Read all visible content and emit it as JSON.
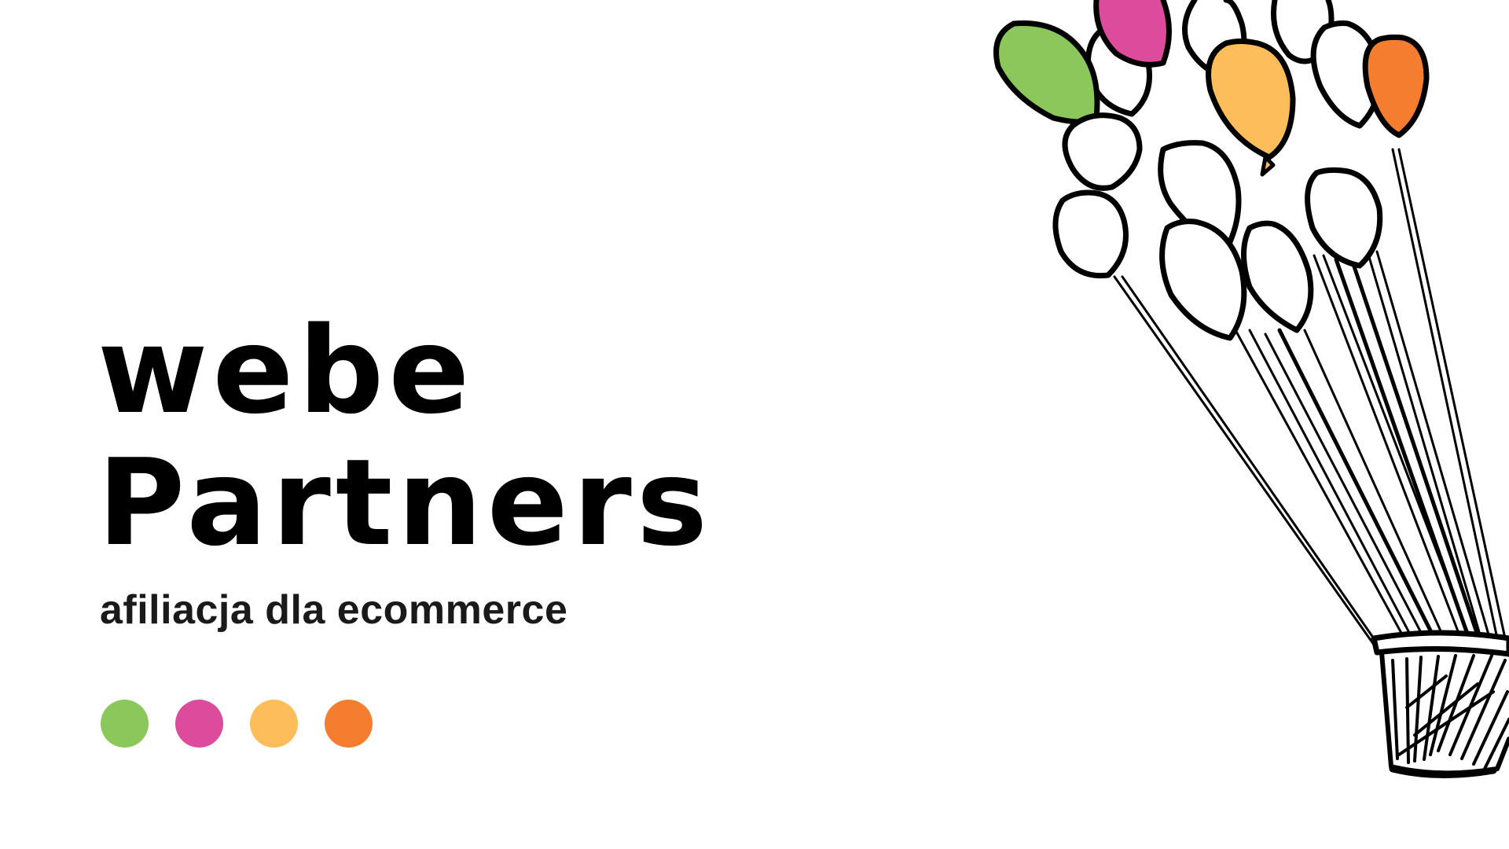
{
  "brand": {
    "line1": "webe",
    "line2": "Partners"
  },
  "tagline": "afiliacja dla ecommerce",
  "dots": [
    {
      "color": "#8BC75A"
    },
    {
      "color": "#DD4C9C"
    },
    {
      "color": "#FDBD5B"
    },
    {
      "color": "#F47D30"
    }
  ],
  "illustration": {
    "icon": "balloon-basket-icon",
    "colors": {
      "green": "#8BC75A",
      "pink": "#DD4C9C",
      "yellow": "#FDBD5B",
      "orange": "#F47D30",
      "outline": "#000000",
      "fill": "#FFFFFF"
    }
  }
}
